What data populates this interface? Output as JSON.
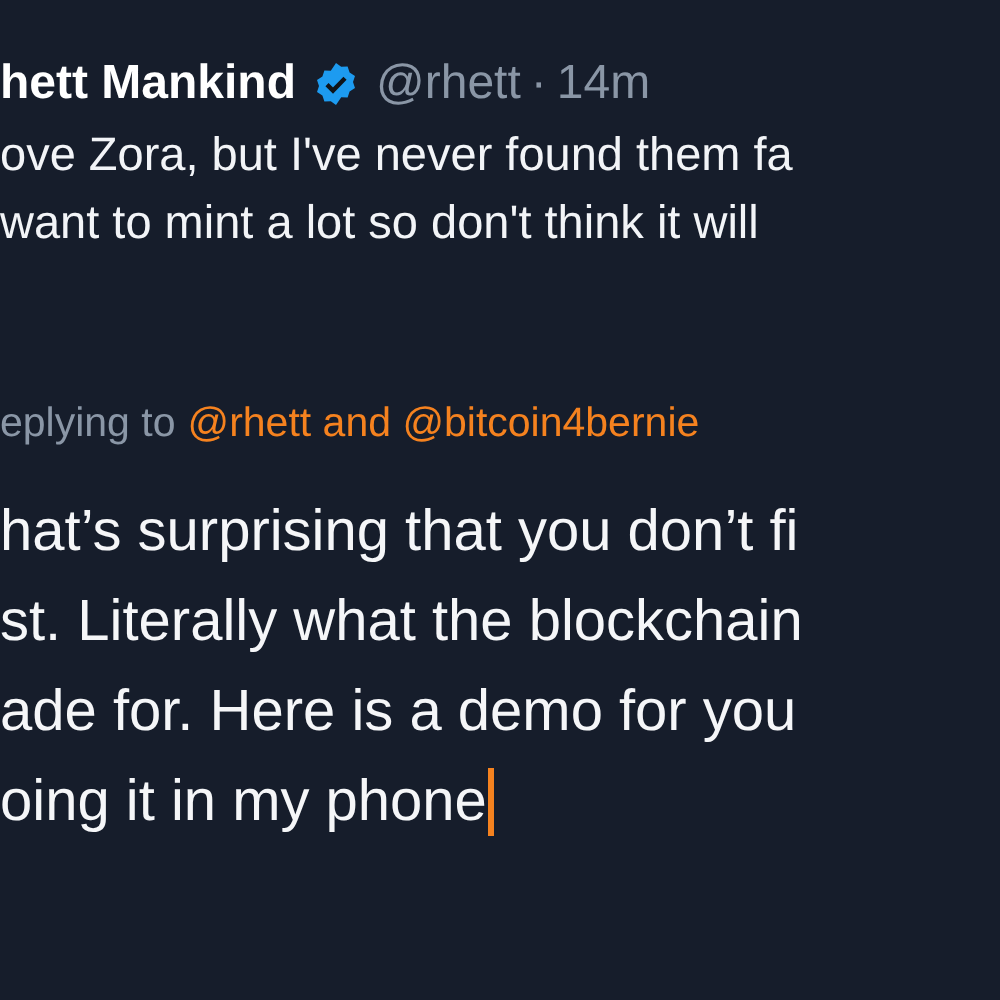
{
  "tweet": {
    "author_name": "hett Mankind",
    "verified": true,
    "handle": "@rhett",
    "separator": "·",
    "time": "14m",
    "text_lines": [
      "ove Zora, but I've never found them fa",
      "want to mint a lot so don't think it will"
    ]
  },
  "replying_to": {
    "label": "eplying to",
    "mentions": "@rhett and @bitcoin4bernie"
  },
  "reply": {
    "value_lines": [
      "hat’s surprising that you don’t fi",
      "st. Literally what the blockchain",
      "ade for. Here is a demo for you",
      "oing it in my phone"
    ],
    "focused": true
  }
}
